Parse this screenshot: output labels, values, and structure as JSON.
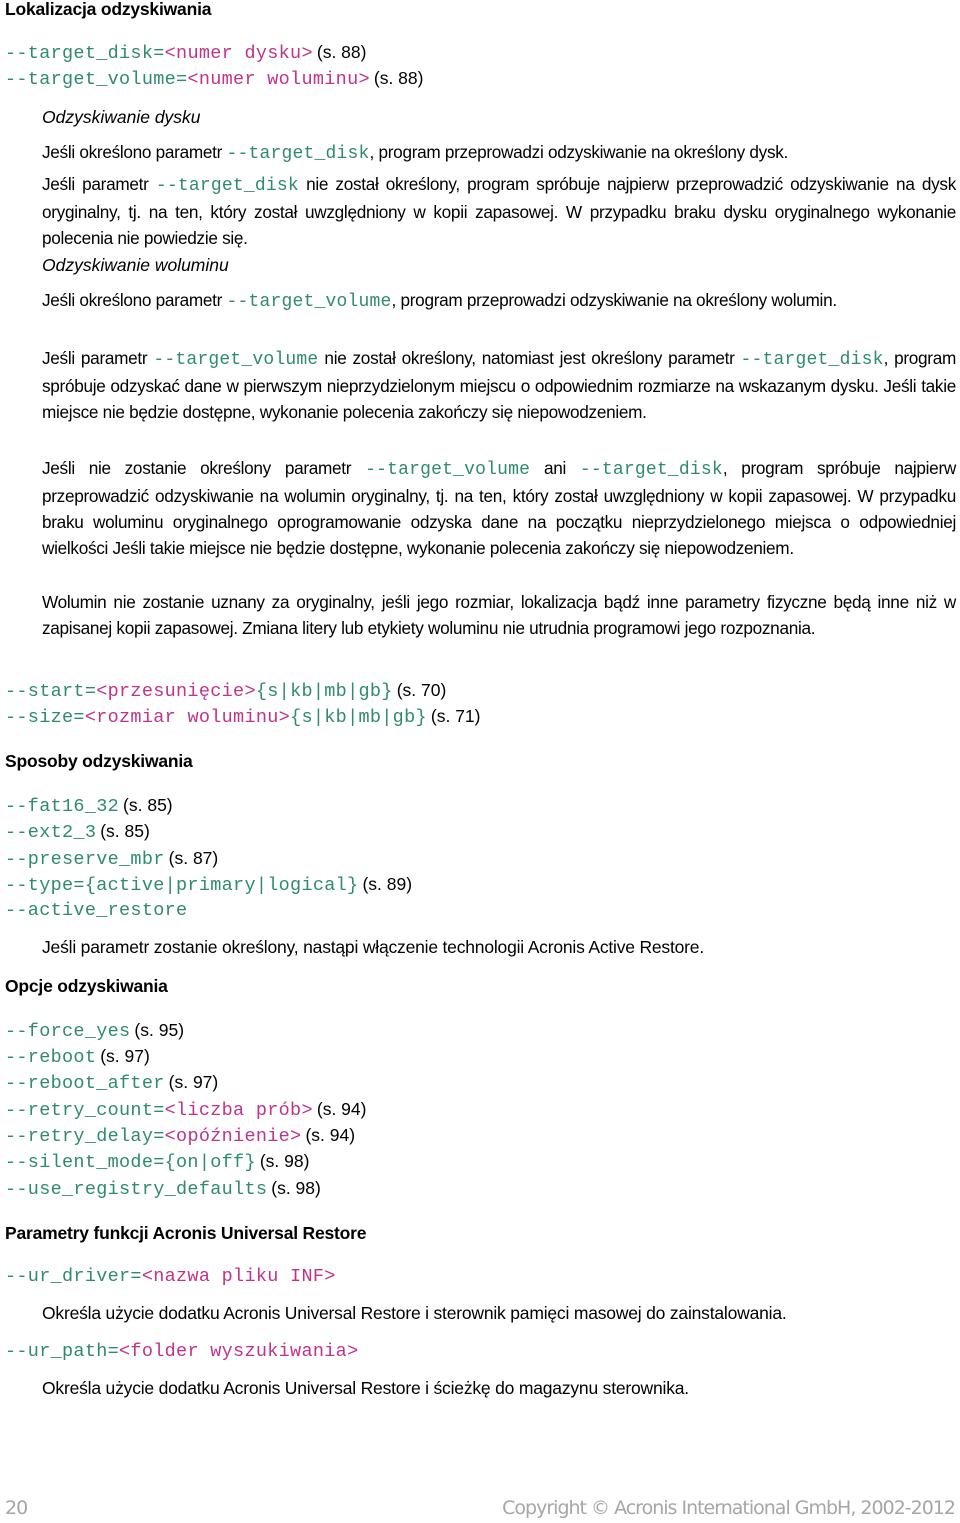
{
  "section_location": {
    "heading": "Lokalizacja odzyskiwania",
    "params": [
      {
        "name": "--target_disk=",
        "placeholder": "<numer dysku>",
        "ref": "(s. 88)"
      },
      {
        "name": "--target_volume=",
        "placeholder": "<numer woluminu>",
        "ref": "(s. 88)"
      }
    ],
    "disk": {
      "subheading": "Odzyskiwanie dysku",
      "p1": {
        "a": "Jeśli określono parametr ",
        "code": "--target_disk",
        "b": ", program przeprowadzi odzyskiwanie na określony dysk."
      },
      "p2": {
        "a": "Jeśli parametr ",
        "code": "--target_disk",
        "b": " nie został określony, program spróbuje najpierw przeprowadzić odzyskiwanie na dysk oryginalny, tj. na ten, który został uwzględniony w kopii zapasowej. W przypadku braku dysku oryginalnego wykonanie polecenia nie powiedzie się."
      }
    },
    "volume": {
      "subheading": "Odzyskiwanie woluminu",
      "p1": {
        "a": "Jeśli określono parametr ",
        "code": "--target_volume",
        "b": ", program przeprowadzi odzyskiwanie na określony wolumin."
      },
      "p2": {
        "a": "Jeśli parametr ",
        "code1": "--target_volume",
        "b": " nie został określony, natomiast jest określony parametr ",
        "code2": "--target_disk",
        "c": ", program spróbuje odzyskać dane w pierwszym nieprzydzielonym miejscu o odpowiednim rozmiarze na wskazanym dysku. Jeśli takie miejsce nie będzie dostępne, wykonanie polecenia zakończy się niepowodzeniem."
      },
      "p3": {
        "a": "Jeśli nie zostanie określony parametr ",
        "code1": "--target_volume",
        "b": " ani ",
        "code2": "--target_disk",
        "c": ", program spróbuje najpierw przeprowadzić odzyskiwanie na wolumin oryginalny, tj. na ten, który został uwzględniony w kopii zapasowej. W przypadku braku woluminu oryginalnego oprogramowanie odzyska dane na początku nieprzydzielonego miejsca o odpowiedniej wielkości Jeśli takie miejsce nie będzie dostępne, wykonanie polecenia zakończy się niepowodzeniem."
      },
      "p4": "Wolumin nie zostanie uznany za oryginalny, jeśli jego rozmiar, lokalizacja bądź inne parametry fizyczne będą inne niż w zapisanej kopii zapasowej. Zmiana litery lub etykiety woluminu nie utrudnia programowi jego rozpoznania."
    },
    "size_params": [
      {
        "name": "--start=",
        "placeholder": "<przesunięcie>",
        "units": "{s|kb|mb|gb}",
        "ref": "(s. 70)"
      },
      {
        "name": "--size=",
        "placeholder": "<rozmiar woluminu>",
        "units": "{s|kb|mb|gb}",
        "ref": "(s. 71)"
      }
    ]
  },
  "section_methods": {
    "heading": "Sposoby odzyskiwania",
    "params": [
      {
        "name": "--fat16_32",
        "ref": "(s. 85)"
      },
      {
        "name": "--ext2_3",
        "ref": "(s. 85)"
      },
      {
        "name": "--preserve_mbr",
        "ref": "(s. 87)"
      },
      {
        "name": "--type={active|primary|logical}",
        "ref": "(s. 89)"
      },
      {
        "name": "--active_restore",
        "ref": ""
      }
    ],
    "active_restore_desc": "Jeśli parametr zostanie określony, nastąpi włączenie technologii Acronis Active Restore."
  },
  "section_options": {
    "heading": "Opcje odzyskiwania",
    "params": [
      {
        "name": "--force_yes",
        "placeholder": "",
        "suffix": "",
        "ref": "(s. 95)"
      },
      {
        "name": "--reboot",
        "placeholder": "",
        "suffix": "",
        "ref": "(s. 97)"
      },
      {
        "name": "--reboot_after",
        "placeholder": "",
        "suffix": "",
        "ref": "(s. 97)"
      },
      {
        "name": "--retry_count=",
        "placeholder": "<liczba prób>",
        "suffix": "",
        "ref": "(s. 94)"
      },
      {
        "name": "--retry_delay=",
        "placeholder": "<opóźnienie>",
        "suffix": "",
        "ref": "(s. 94)"
      },
      {
        "name": "--silent_mode={on|off}",
        "placeholder": "",
        "suffix": "",
        "ref": "(s. 98)"
      },
      {
        "name": "--use_registry_defaults",
        "placeholder": "",
        "suffix": "",
        "ref": "(s. 98)"
      }
    ]
  },
  "section_ur": {
    "heading": "Parametry funkcji Acronis Universal Restore",
    "params": [
      {
        "name": "--ur_driver=",
        "placeholder": "<nazwa pliku INF>",
        "desc": "Określa użycie dodatku Acronis Universal Restore i sterownik pamięci masowej do zainstalowania."
      },
      {
        "name": "--ur_path=",
        "placeholder": "<folder wyszukiwania>",
        "desc": "Określa użycie dodatku Acronis Universal Restore i ścieżkę do magazynu sterownika."
      }
    ]
  },
  "footer": {
    "page_number": "20",
    "copyright": "Copyright © Acronis International GmbH, 2002-2012"
  },
  "colors": {
    "parameter": "#2e8b6e",
    "placeholder": "#c0338a",
    "footer": "#a6a6a6"
  }
}
